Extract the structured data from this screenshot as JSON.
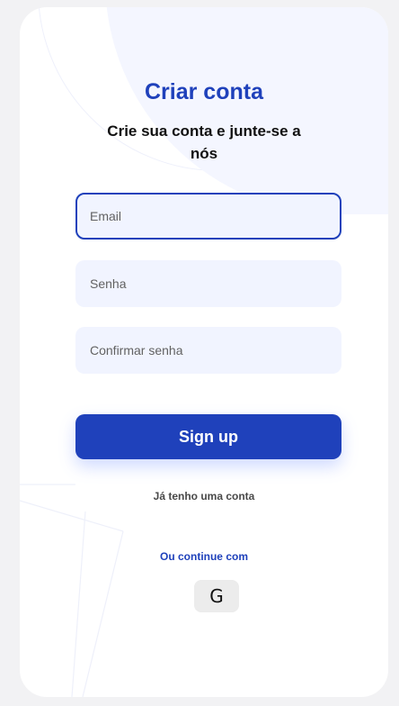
{
  "heading": {
    "title": "Criar conta",
    "subtitle": "Crie sua conta e junte-se a nós"
  },
  "form": {
    "email_placeholder": "Email",
    "password_placeholder": "Senha",
    "confirm_placeholder": "Confirmar senha",
    "focused_field": "email",
    "signup_label": "Sign up"
  },
  "footer": {
    "have_account": "Já tenho uma conta",
    "continue_with": "Ou continue com",
    "google_glyph": "G"
  },
  "colors": {
    "primary": "#1f41bb",
    "field_bg": "#f1f4ff",
    "page_bg": "#f2f2f4"
  },
  "icons": {
    "google": "google-icon"
  }
}
